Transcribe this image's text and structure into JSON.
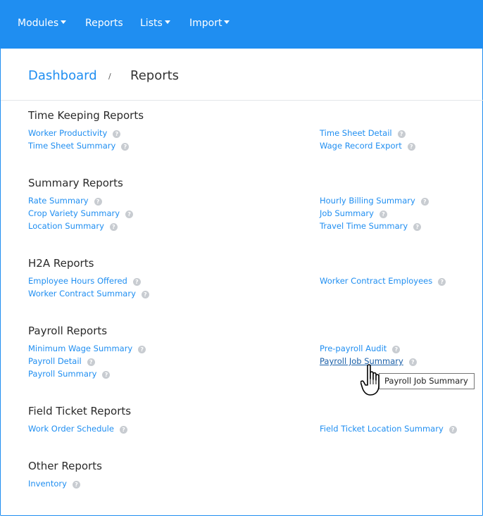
{
  "navbar": {
    "items": [
      {
        "label": "Modules",
        "dropdown": true
      },
      {
        "label": "Reports",
        "dropdown": false
      },
      {
        "label": "Lists",
        "dropdown": true
      },
      {
        "label": "Import",
        "dropdown": true
      }
    ]
  },
  "breadcrumb": {
    "home": "Dashboard",
    "separator": "/",
    "current": "Reports"
  },
  "sections": [
    {
      "title": "Time Keeping Reports",
      "left": [
        "Worker Productivity",
        "Time Sheet Summary"
      ],
      "right": [
        "Time Sheet Detail",
        "Wage Record Export"
      ]
    },
    {
      "title": "Summary Reports",
      "left": [
        "Rate Summary",
        "Crop Variety Summary",
        "Location Summary"
      ],
      "right": [
        "Hourly Billing Summary",
        "Job Summary",
        "Travel Time Summary"
      ]
    },
    {
      "title": "H2A Reports",
      "left": [
        "Employee Hours Offered",
        "Worker Contract Summary"
      ],
      "right": [
        "Worker Contract Employees"
      ]
    },
    {
      "title": "Payroll Reports",
      "left": [
        "Minimum Wage Summary",
        "Payroll Detail",
        "Payroll Summary"
      ],
      "right": [
        "Pre-payroll Audit",
        "Payroll Job Summary"
      ]
    },
    {
      "title": "Field Ticket Reports",
      "left": [
        "Work Order Schedule"
      ],
      "right": [
        "Field Ticket Location Summary"
      ]
    },
    {
      "title": "Other Reports",
      "left": [
        "Inventory"
      ],
      "right": []
    }
  ],
  "help_glyph": "?",
  "tooltip": {
    "text": "Payroll Job Summary"
  },
  "icons": {
    "help": "question-circle-icon",
    "cursor": "hand-pointer-cursor"
  },
  "colors": {
    "navbar": "#1f8ef1",
    "link": "#1f8ef1",
    "link_hover": "#1a5fa8"
  }
}
